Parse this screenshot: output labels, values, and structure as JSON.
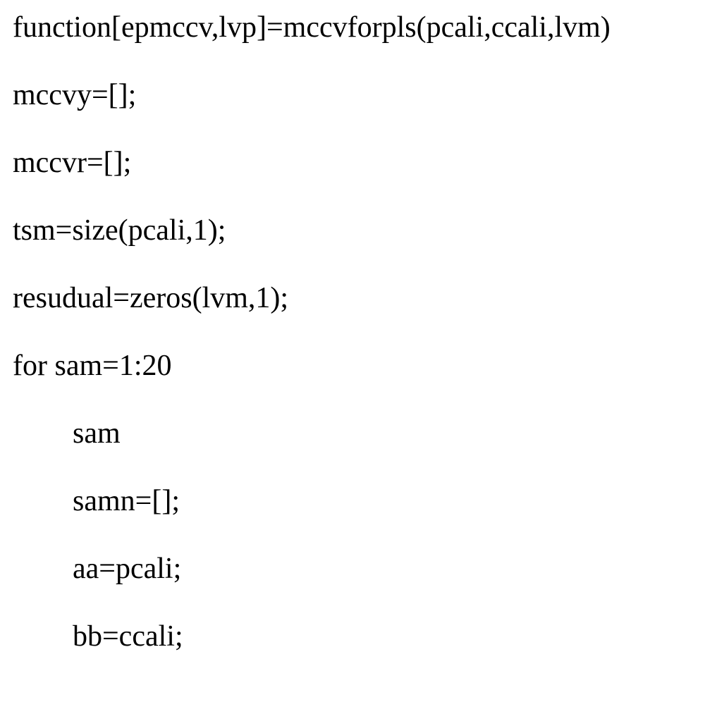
{
  "code": {
    "lines": [
      {
        "text": "function[epmccv,lvp]=mccvforpls(pcali,ccali,lvm)",
        "indent": false
      },
      {
        "text": "mccvy=[];",
        "indent": false
      },
      {
        "text": "mccvr=[];",
        "indent": false
      },
      {
        "text": "tsm=size(pcali,1);",
        "indent": false
      },
      {
        "text": "resudual=zeros(lvm,1);",
        "indent": false
      },
      {
        "text": "for sam=1:20",
        "indent": false
      },
      {
        "text": "sam",
        "indent": true
      },
      {
        "text": "samn=[];",
        "indent": true
      },
      {
        "text": "aa=pcali;",
        "indent": true
      },
      {
        "text": "bb=ccali;",
        "indent": true
      }
    ]
  }
}
